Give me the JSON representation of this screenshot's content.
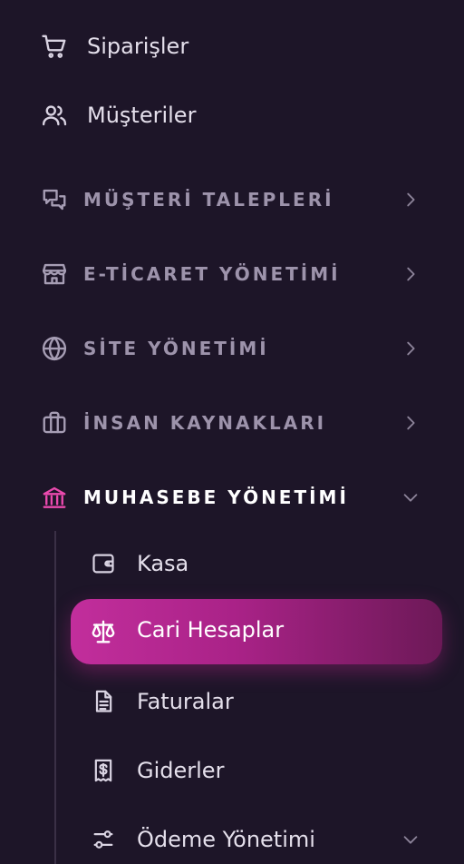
{
  "menu": {
    "top": [
      {
        "label": "Siparişler",
        "icon": "cart-icon"
      },
      {
        "label": "Müşteriler",
        "icon": "users-icon"
      }
    ],
    "sections": [
      {
        "label": "MÜŞTERİ TALEPLERİ",
        "icon": "chat-icon",
        "expanded": false
      },
      {
        "label": "E-TİCARET YÖNETİMİ",
        "icon": "store-icon",
        "expanded": false
      },
      {
        "label": "SİTE YÖNETİMİ",
        "icon": "globe-icon",
        "expanded": false
      },
      {
        "label": "İNSAN KAYNAKLARI",
        "icon": "briefcase-icon",
        "expanded": false
      },
      {
        "label": "MUHASEBE YÖNETİMİ",
        "icon": "bank-icon",
        "expanded": true
      }
    ],
    "accounting_items": [
      {
        "label": "Kasa",
        "icon": "wallet-icon"
      },
      {
        "label": "Cari Hesaplar",
        "icon": "scale-icon",
        "active": true
      },
      {
        "label": "Faturalar",
        "icon": "document-icon"
      },
      {
        "label": "Giderler",
        "icon": "receipt-dollar-icon"
      },
      {
        "label": "Ödeme Yönetimi",
        "icon": "sliders-icon",
        "has_submenu": true
      }
    ]
  },
  "colors": {
    "background": "#1d1528",
    "accent": "#ea4aae",
    "active_gradient_start": "#c22e9c",
    "active_gradient_end": "#6c1957"
  }
}
